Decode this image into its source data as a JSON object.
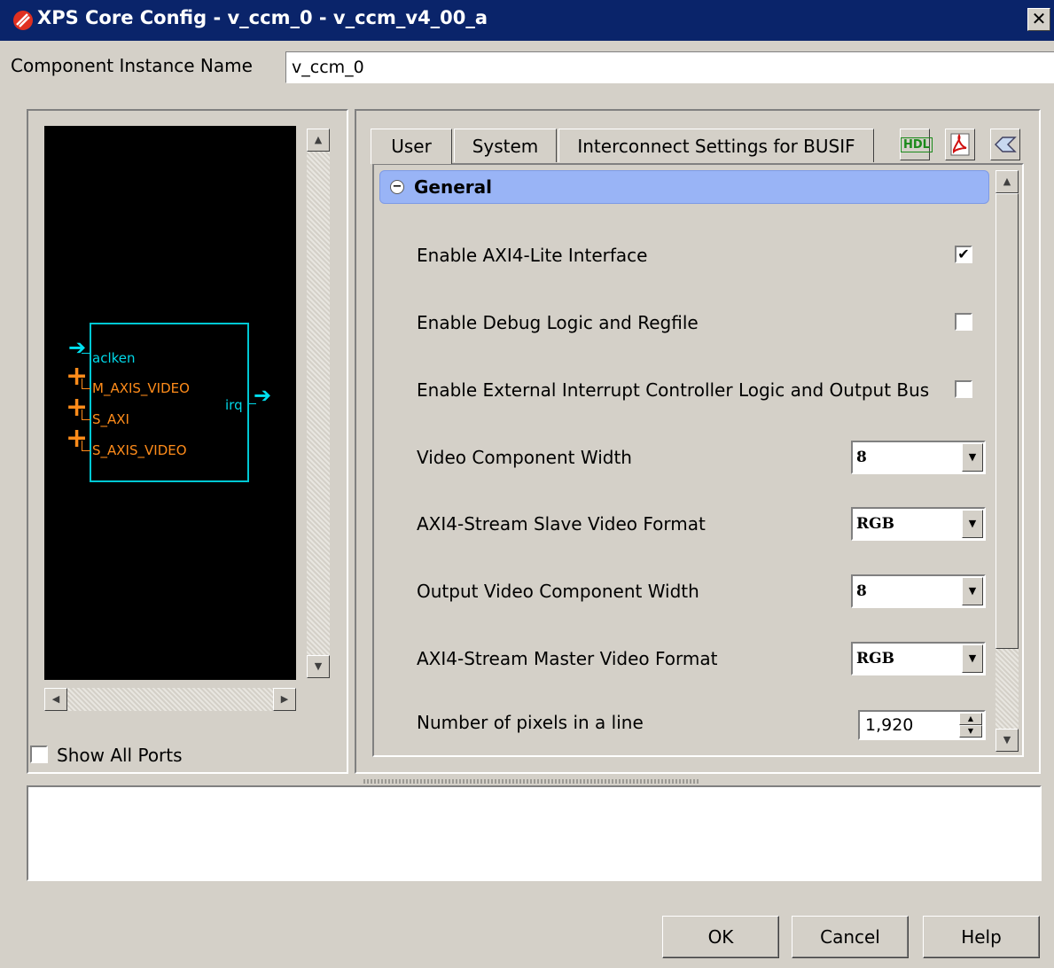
{
  "window": {
    "title": "XPS Core Config - v_ccm_0 - v_ccm_v4_00_a",
    "close_glyph": "✕"
  },
  "instance": {
    "label": "Component Instance Name",
    "value": "v_ccm_0"
  },
  "symbol": {
    "ports": {
      "aclken": "aclken",
      "m_axis_video": "M_AXIS_VIDEO",
      "s_axi": "S_AXI",
      "s_axis_video": "S_AXIS_VIDEO",
      "irq": "irq"
    },
    "colors": {
      "canvas": "#000000",
      "box": "#00c8d4",
      "bus_port": "#ff8c1a",
      "signal_port": "#00d8e8"
    }
  },
  "show_all_ports": {
    "label": "Show All Ports",
    "checked": false
  },
  "tabs": [
    {
      "label": "User",
      "active": true
    },
    {
      "label": "System",
      "active": false
    },
    {
      "label": "Interconnect Settings for BUSIF",
      "active": false
    }
  ],
  "toolbar": {
    "hdl_label": "HDL",
    "icons": [
      "hdl-icon",
      "pdf-datasheet-icon",
      "change-log-icon"
    ]
  },
  "group": {
    "title": "General",
    "collapsed": false,
    "header_color": "#99b4f6"
  },
  "params": {
    "axi4_lite": {
      "label": "Enable AXI4-Lite Interface",
      "checked": true,
      "mark": "✔"
    },
    "debug": {
      "label": "Enable Debug Logic and Regfile",
      "checked": false
    },
    "intc": {
      "label": "Enable External Interrupt Controller Logic and Output Bus",
      "checked": false
    },
    "video_width": {
      "label": "Video Component Width",
      "value": "8"
    },
    "slave_format": {
      "label": "AXI4-Stream Slave Video Format",
      "value": "RGB"
    },
    "out_width": {
      "label": "Output Video Component Width",
      "value": "8"
    },
    "master_format": {
      "label": "AXI4-Stream Master Video Format",
      "value": "RGB"
    },
    "pixels": {
      "label": "Number of pixels in a line",
      "value": "1,920"
    }
  },
  "buttons": {
    "ok": "OK",
    "cancel": "Cancel",
    "help": "Help"
  }
}
